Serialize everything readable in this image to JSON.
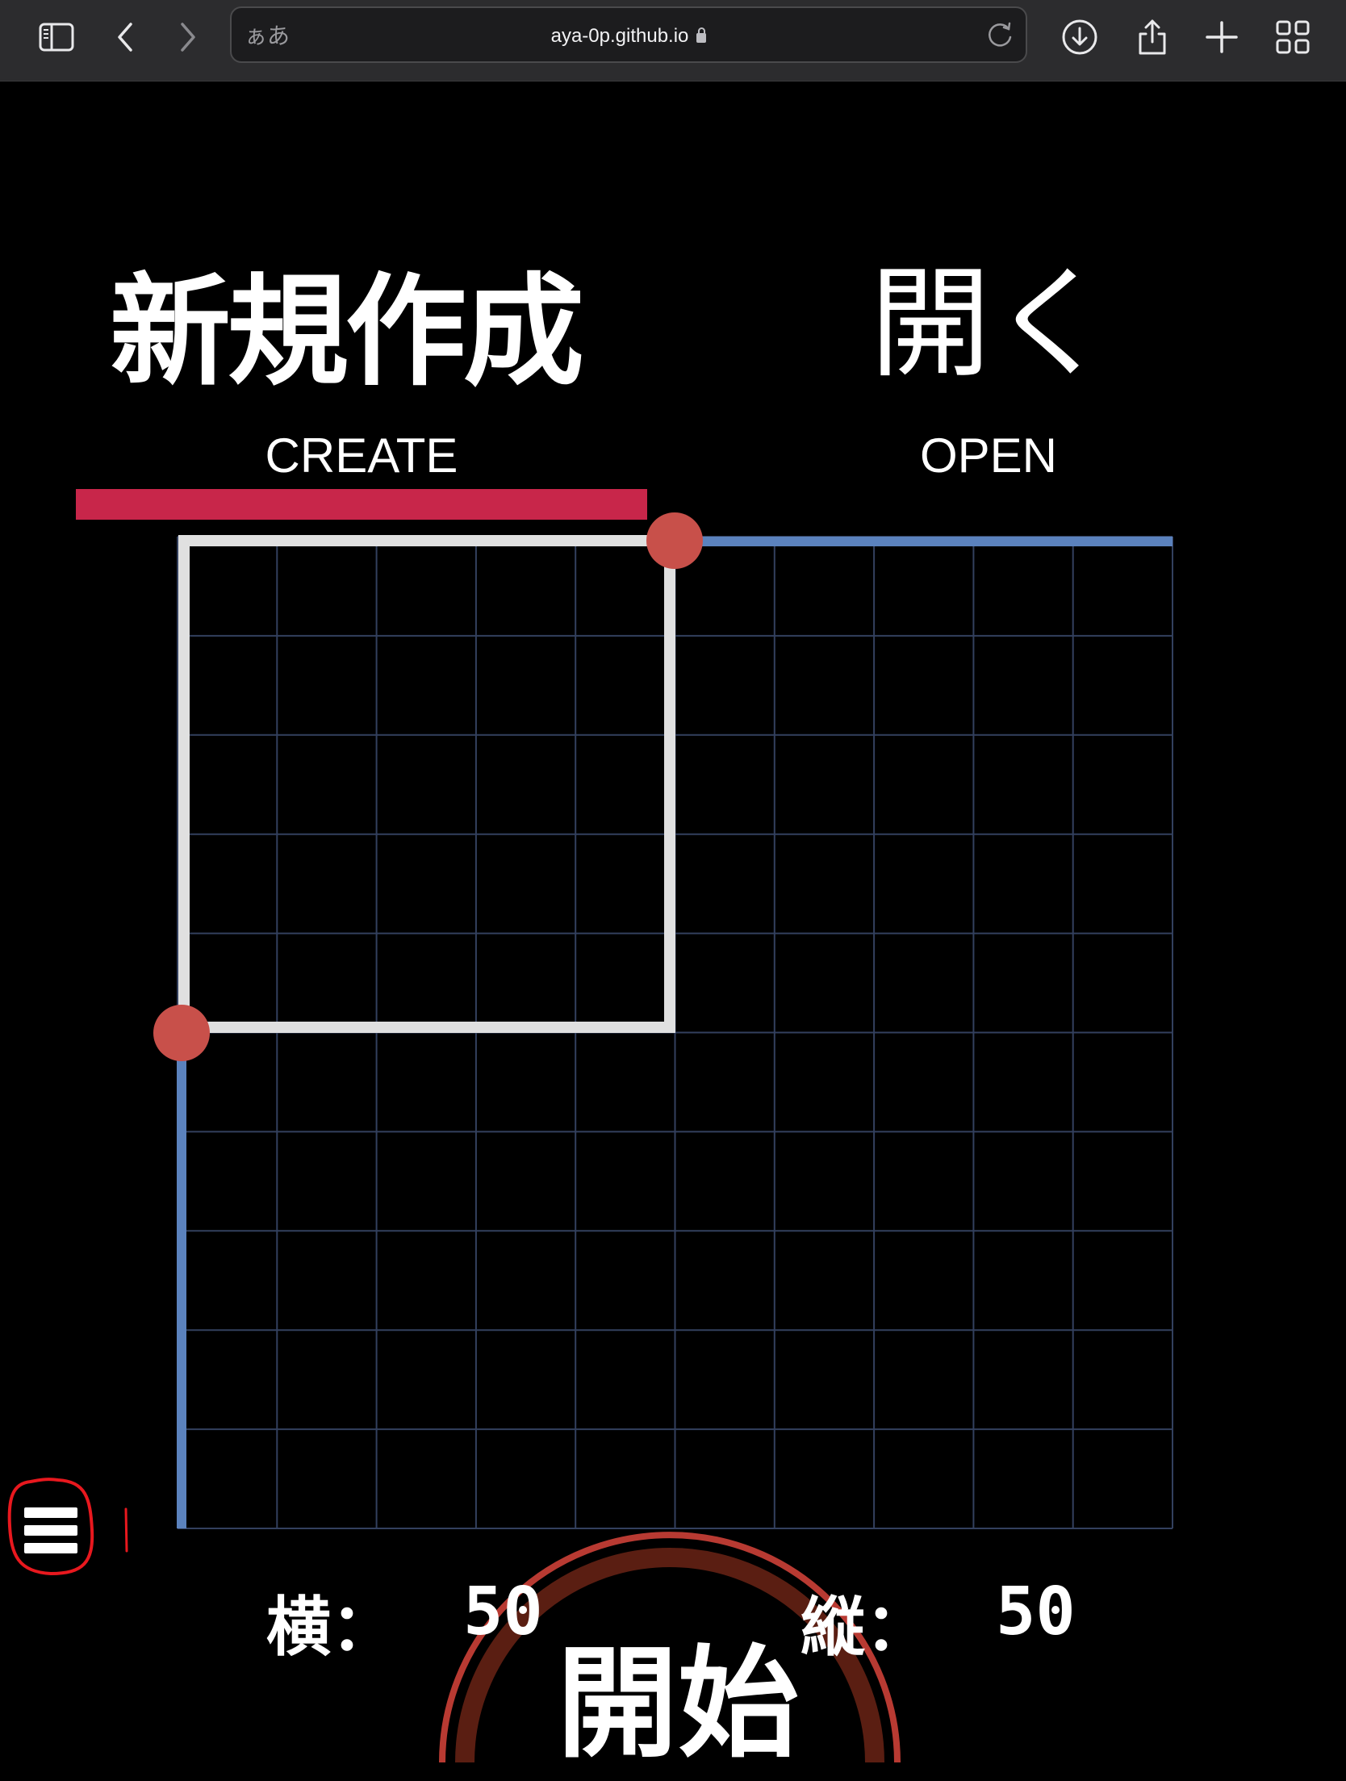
{
  "browser": {
    "address_prefix": "ぁあ",
    "url": "aya-0p.github.io",
    "icons": [
      "sidebar-icon",
      "back-icon",
      "forward-icon",
      "lock-icon",
      "reload-icon",
      "download-icon",
      "share-icon",
      "new-tab-icon",
      "tab-overview-icon"
    ]
  },
  "tabs": {
    "create_title": "新規作成",
    "create_label": "CREATE",
    "open_title": "開く",
    "open_label": "OPEN",
    "active": "create",
    "indicator_color": "#c8264a"
  },
  "grid": {
    "columns": 10,
    "rows": 10,
    "line_color": "#33405e",
    "frame_color": "#e0e0e0",
    "handle_color": "#c8504a",
    "axis_color": "#5b82bd"
  },
  "settings": {
    "width_label": "横：",
    "width_value": "50",
    "height_label": "縦：",
    "height_value": "50"
  },
  "start_button": {
    "label": "開始",
    "ring_color": "#b83a32"
  },
  "menu": {
    "icon": "hamburger-menu-icon",
    "annotation_color": "#e8181e"
  }
}
